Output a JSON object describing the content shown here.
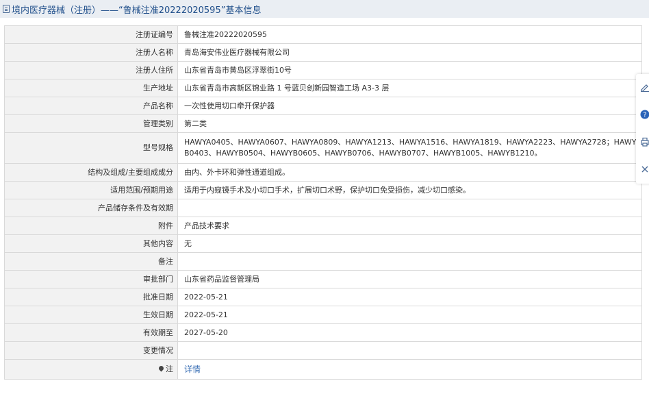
{
  "header": {
    "title": "境内医疗器械（注册）——“鲁械注准20222020595”基本信息"
  },
  "rows": [
    {
      "label": "注册证编号",
      "value": "鲁械注准20222020595"
    },
    {
      "label": "注册人名称",
      "value": "青岛海安伟业医疗器械有限公司"
    },
    {
      "label": "注册人住所",
      "value": "山东省青岛市黄岛区浮翠街10号"
    },
    {
      "label": "生产地址",
      "value": "山东省青岛市高新区锦业路 1 号蓝贝创新园智造工场 A3-3 层"
    },
    {
      "label": "产品名称",
      "value": "一次性使用切口牵开保护器"
    },
    {
      "label": "管理类别",
      "value": "第二类"
    },
    {
      "label": "型号规格",
      "value": "HAWYA0405、HAWYA0607、HAWYA0809、HAWYA1213、HAWYA1516、HAWYA1819、HAWYA2223、HAWYA2728；HAWYB0403、HAWYB0504、HAWYB0605、HAWYB0706、HAWYB0707、HAWYB1005、HAWYB1210。"
    },
    {
      "label": "结构及组成/主要组成成分",
      "value": "由内、外卡环和弹性通道组成。"
    },
    {
      "label": "适用范围/预期用途",
      "value": "适用于内窥镜手术及小切口手术，扩展切口术野，保护切口免受损伤，减少切口感染。"
    },
    {
      "label": "产品储存条件及有效期",
      "value": ""
    },
    {
      "label": "附件",
      "value": "产品技术要求"
    },
    {
      "label": "其他内容",
      "value": "无"
    },
    {
      "label": "备注",
      "value": ""
    },
    {
      "label": "审批部门",
      "value": "山东省药品监督管理局"
    },
    {
      "label": "批准日期",
      "value": "2022-05-21"
    },
    {
      "label": "生效日期",
      "value": "2022-05-21"
    },
    {
      "label": "有效期至",
      "value": "2027-05-20"
    },
    {
      "label": "变更情况",
      "value": ""
    }
  ],
  "note_row": {
    "label": "注",
    "link_text": "详情"
  },
  "icons": {
    "header": "document-icon",
    "note": "pin-icon",
    "side_panel": [
      "edit-icon",
      "help-icon",
      "print-icon",
      "close-icon"
    ]
  },
  "colors": {
    "header_bg": "#eaeef3",
    "header_text": "#1f4e8a",
    "label_bg": "#f2f2f2",
    "border": "#d9d9d9",
    "link": "#3a6fb5"
  }
}
